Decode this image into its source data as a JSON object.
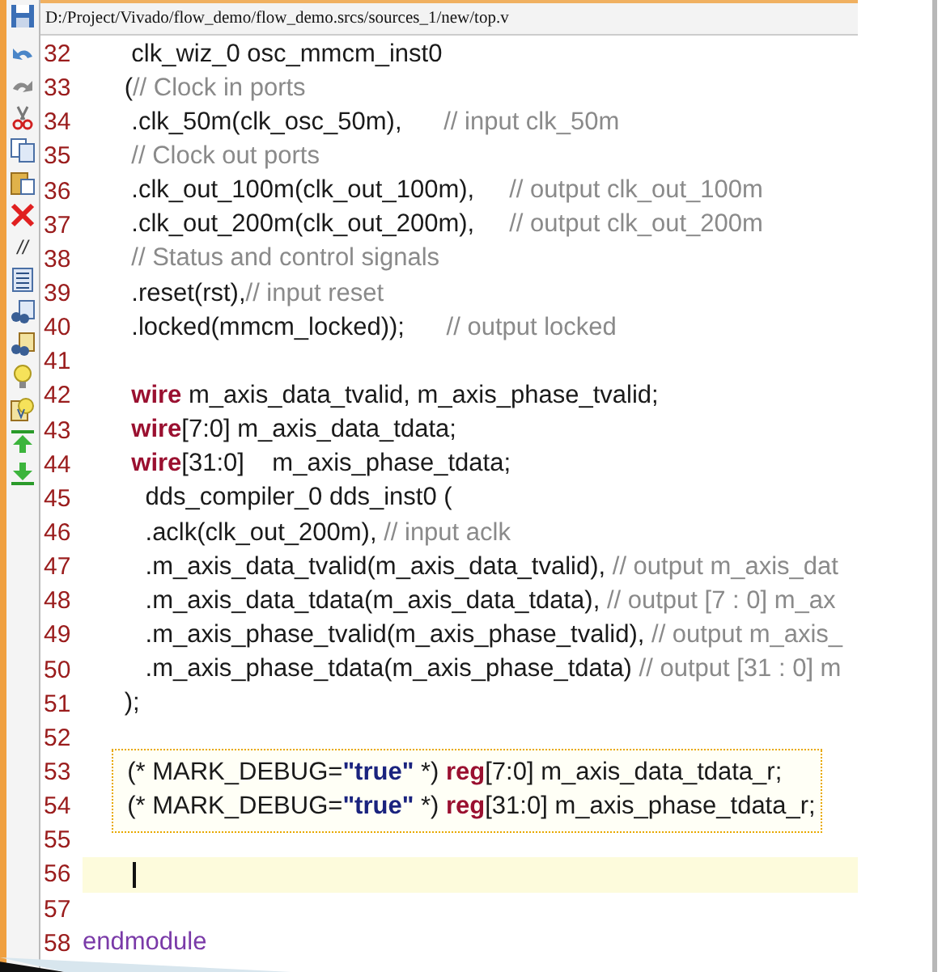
{
  "file_path": "D:/Project/Vivado/flow_demo/flow_demo.srcs/sources_1/new/top.v",
  "toolbar": {
    "comment_glyph": "//"
  },
  "lines": [
    {
      "number": "32",
      "tokens": [
        {
          "kind": "plain",
          "text": "       clk_wiz_0 osc_mmcm_inst0"
        }
      ]
    },
    {
      "number": "33",
      "tokens": [
        {
          "kind": "plain",
          "text": "      ("
        },
        {
          "kind": "comment",
          "text": "// Clock in ports"
        }
      ]
    },
    {
      "number": "34",
      "tokens": [
        {
          "kind": "plain",
          "text": "       .clk_50m(clk_osc_50m),      "
        },
        {
          "kind": "comment",
          "text": "// input clk_50m"
        }
      ]
    },
    {
      "number": "35",
      "tokens": [
        {
          "kind": "comment",
          "text": "       // Clock out ports"
        }
      ]
    },
    {
      "number": "36",
      "tokens": [
        {
          "kind": "plain",
          "text": "       .clk_out_100m(clk_out_100m),     "
        },
        {
          "kind": "comment",
          "text": "// output clk_out_100m"
        }
      ]
    },
    {
      "number": "37",
      "tokens": [
        {
          "kind": "plain",
          "text": "       .clk_out_200m(clk_out_200m),     "
        },
        {
          "kind": "comment",
          "text": "// output clk_out_200m"
        }
      ]
    },
    {
      "number": "38",
      "tokens": [
        {
          "kind": "comment",
          "text": "       // Status and control signals"
        }
      ]
    },
    {
      "number": "39",
      "tokens": [
        {
          "kind": "plain",
          "text": "       .reset(rst),"
        },
        {
          "kind": "comment",
          "text": "// input reset"
        }
      ]
    },
    {
      "number": "40",
      "tokens": [
        {
          "kind": "plain",
          "text": "       .locked(mmcm_locked));      "
        },
        {
          "kind": "comment",
          "text": "// output locked"
        }
      ]
    },
    {
      "number": "41"
    },
    {
      "number": "42",
      "tokens": [
        {
          "kind": "keyword",
          "text": "       wire"
        },
        {
          "kind": "plain",
          "text": " m_axis_data_tvalid, m_axis_phase_tvalid;"
        }
      ]
    },
    {
      "number": "43",
      "tokens": [
        {
          "kind": "keyword",
          "text": "       wire"
        },
        {
          "kind": "plain",
          "text": "[7:0] m_axis_data_tdata;"
        }
      ]
    },
    {
      "number": "44",
      "tokens": [
        {
          "kind": "keyword",
          "text": "       wire"
        },
        {
          "kind": "plain",
          "text": "[31:0]    m_axis_phase_tdata;"
        }
      ]
    },
    {
      "number": "45",
      "tokens": [
        {
          "kind": "plain",
          "text": "         dds_compiler_0 dds_inst0 ("
        }
      ]
    },
    {
      "number": "46",
      "tokens": [
        {
          "kind": "plain",
          "text": "         .aclk(clk_out_200m), "
        },
        {
          "kind": "comment",
          "text": "// input aclk"
        }
      ]
    },
    {
      "number": "47",
      "tokens": [
        {
          "kind": "plain",
          "text": "         .m_axis_data_tvalid(m_axis_data_tvalid), "
        },
        {
          "kind": "comment",
          "text": "// output m_axis_dat"
        }
      ]
    },
    {
      "number": "48",
      "tokens": [
        {
          "kind": "plain",
          "text": "         .m_axis_data_tdata(m_axis_data_tdata), "
        },
        {
          "kind": "comment",
          "text": "// output [7 : 0] m_ax"
        }
      ]
    },
    {
      "number": "49",
      "tokens": [
        {
          "kind": "plain",
          "text": "         .m_axis_phase_tvalid(m_axis_phase_tvalid), "
        },
        {
          "kind": "comment",
          "text": "// output m_axis_"
        }
      ]
    },
    {
      "number": "50",
      "tokens": [
        {
          "kind": "plain",
          "text": "         .m_axis_phase_tdata(m_axis_phase_tdata) "
        },
        {
          "kind": "comment",
          "text": "// output [31 : 0] m"
        }
      ]
    },
    {
      "number": "51",
      "tokens": [
        {
          "kind": "plain",
          "text": "      );"
        }
      ]
    },
    {
      "number": "52"
    },
    {
      "number": "53",
      "boxed": true,
      "tokens": [
        {
          "kind": "plain",
          "text": "  (* MARK_DEBUG="
        },
        {
          "kind": "string",
          "text": "\"true\""
        },
        {
          "kind": "plain",
          "text": " *) "
        },
        {
          "kind": "keyword",
          "text": "reg"
        },
        {
          "kind": "plain",
          "text": "[7:0] m_axis_data_tdata_r;"
        }
      ]
    },
    {
      "number": "54",
      "boxed": true,
      "tokens": [
        {
          "kind": "plain",
          "text": "  (* MARK_DEBUG="
        },
        {
          "kind": "string",
          "text": "\"true\""
        },
        {
          "kind": "plain",
          "text": " *) "
        },
        {
          "kind": "keyword",
          "text": "reg"
        },
        {
          "kind": "plain",
          "text": "[31:0] m_axis_phase_tdata_r;"
        }
      ]
    },
    {
      "number": "55"
    },
    {
      "number": "56",
      "current": true
    },
    {
      "number": "57"
    },
    {
      "number": "58",
      "tokens": [
        {
          "kind": "module",
          "text": "endmodule"
        }
      ]
    }
  ]
}
